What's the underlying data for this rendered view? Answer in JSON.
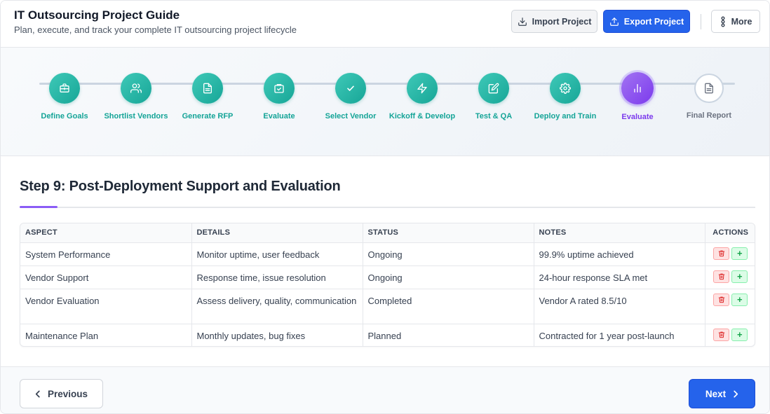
{
  "header": {
    "title": "IT Outsourcing Project Guide",
    "subtitle": "Plan, execute, and track your complete IT outsourcing project lifecycle",
    "import_label": "Import Project",
    "export_label": "Export Project",
    "more_label": "More"
  },
  "steps": [
    {
      "label": "Define Goals",
      "state": "completed",
      "icon": "briefcase-icon"
    },
    {
      "label": "Shortlist Vendors",
      "state": "completed",
      "icon": "users-icon"
    },
    {
      "label": "Generate RFP",
      "state": "completed",
      "icon": "document-icon"
    },
    {
      "label": "Evaluate",
      "state": "completed",
      "icon": "clipboard-check-icon"
    },
    {
      "label": "Select Vendor",
      "state": "completed",
      "icon": "check-icon"
    },
    {
      "label": "Kickoff & Develop",
      "state": "completed",
      "icon": "lightning-icon"
    },
    {
      "label": "Test & QA",
      "state": "completed",
      "icon": "edit-icon"
    },
    {
      "label": "Deploy and Train",
      "state": "completed",
      "icon": "gear-icon"
    },
    {
      "label": "Evaluate",
      "state": "active",
      "icon": "bar-chart-icon"
    },
    {
      "label": "Final Report",
      "state": "pending",
      "icon": "document-icon"
    }
  ],
  "content": {
    "title": "Step 9: Post-Deployment Support and Evaluation",
    "table": {
      "headers": [
        "ASPECT",
        "DETAILS",
        "STATUS",
        "NOTES",
        "ACTIONS"
      ],
      "rows": [
        {
          "aspect": "System Performance",
          "details": "Monitor uptime, user feedback",
          "status": "Ongoing",
          "notes": "99.9% uptime achieved"
        },
        {
          "aspect": "Vendor Support",
          "details": "Response time, issue resolution",
          "status": "Ongoing",
          "notes": "24-hour response SLA met"
        },
        {
          "aspect": "Vendor Evaluation",
          "details": "Assess delivery, quality, communication",
          "status": "Completed",
          "notes": "Vendor A rated 8.5/10"
        },
        {
          "aspect": "Maintenance Plan",
          "details": "Monthly updates, bug fixes",
          "status": "Planned",
          "notes": "Contracted for 1 year post-launch"
        }
      ],
      "add_symbol": "+"
    }
  },
  "footer": {
    "prev_label": "Previous",
    "next_label": "Next"
  },
  "colors": {
    "primary": "#2563eb",
    "completed": "#14a497",
    "active": "#7c3aed",
    "pending": "#6b7280"
  }
}
